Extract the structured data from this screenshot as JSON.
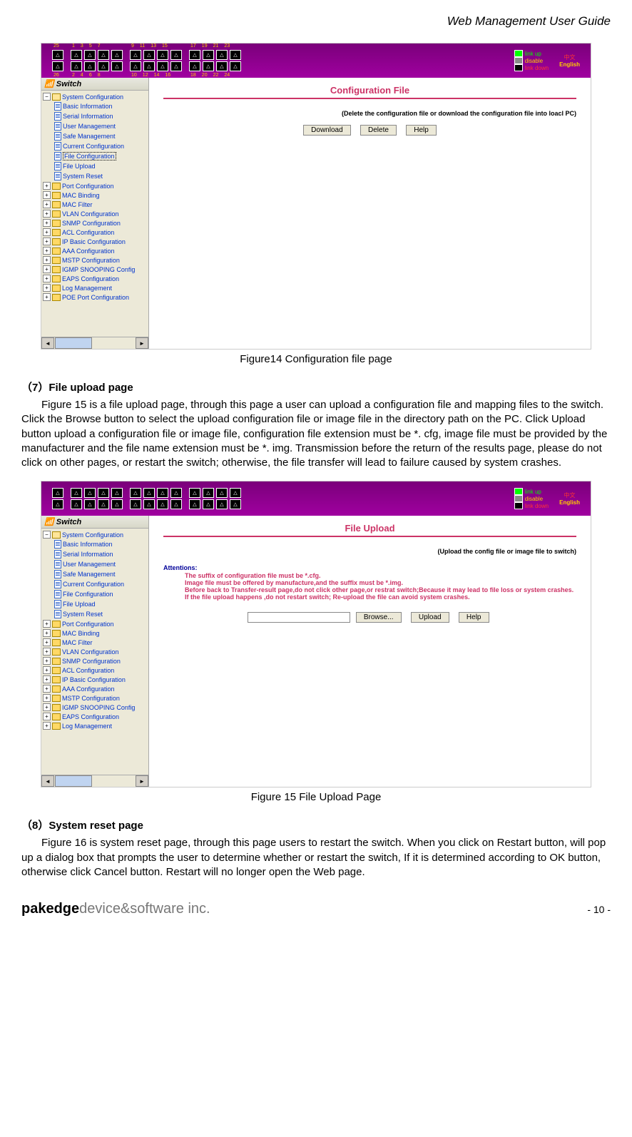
{
  "doc_header": "Web Management User Guide",
  "fig14": {
    "caption": "Figure14 Configuration file page",
    "port_top_labels": [
      "25",
      "",
      "1",
      "3",
      "5",
      "7",
      "",
      "9",
      "11",
      "13",
      "15",
      "",
      "17",
      "19",
      "21",
      "23"
    ],
    "port_bottom_labels": [
      "26",
      "",
      "2",
      "4",
      "6",
      "8",
      "",
      "10",
      "12",
      "14",
      "16",
      "",
      "18",
      "20",
      "22",
      "24"
    ],
    "legend": {
      "link_up": "link up",
      "disable": "disable",
      "link_down": "link down"
    },
    "lang": {
      "cn": "中文",
      "en": "English"
    },
    "sidebar_title": "Switch",
    "tree_l1_open": "System Configuration",
    "tree_l2": [
      "Basic Information",
      "Serial Information",
      "User Management",
      "Safe Management",
      "Current Configuration",
      "File Configuration",
      "File Upload",
      "System Reset"
    ],
    "selected_index": 5,
    "tree_folders": [
      "Port Configuration",
      "MAC Binding",
      "MAC Filter",
      "VLAN Configuration",
      "SNMP Configuration",
      "ACL Configuration",
      "IP Basic Configuration",
      "AAA Configuration",
      "MSTP Configuration",
      "IGMP SNOOPING Config",
      "EAPS Configuration",
      "Log Management",
      "POE Port Configuration"
    ],
    "content_title": "Configuration File",
    "content_note": "(Delete the configuration file or download the configuration file into loacl PC)",
    "buttons": [
      "Download",
      "Delete",
      "Help"
    ]
  },
  "section7": {
    "heading": "（7）File upload page",
    "body": "Figure 15 is a file upload page, through this page a user can upload a configuration file and mapping files to the switch. Click the Browse button to select the upload configuration file or image file in the directory path on the PC. Click Upload button upload a configuration file or image file, configuration file extension must be *. cfg, image file must be provided by the manufacturer and the file name extension must be *. img. Transmission before the return of the results page, please do not click on other pages, or restart the switch; otherwise, the file transfer will lead to failure caused by system crashes."
  },
  "fig15": {
    "caption": "Figure 15 File Upload Page",
    "sidebar_title": "Switch",
    "tree_l1_open": "System Configuration",
    "tree_l2": [
      "Basic Information",
      "Serial Information",
      "User Management",
      "Safe Management",
      "Current Configuration",
      "File Configuration",
      "File Upload",
      "System Reset"
    ],
    "tree_folders": [
      "Port Configuration",
      "MAC Binding",
      "MAC Filter",
      "VLAN Configuration",
      "SNMP Configuration",
      "ACL Configuration",
      "IP Basic Configuration",
      "AAA Configuration",
      "MSTP Configuration",
      "IGMP SNOOPING Config",
      "EAPS Configuration",
      "Log Management"
    ],
    "content_title": "File Upload",
    "content_note": "(Upload the config file or image file to switch)",
    "attentions_label": "Attentions:",
    "attentions_lines": [
      "The suffix of configuration file must be *.cfg.",
      "Image file must be offered by manufacture,and the suffix must be *.img.",
      "Before back to Transfer-result page,do not click other page,or restrat switch;Because it may lead to file loss or system crashes.",
      "If the file upload happens ,do not restart switch; Re-upload the file can avoid system crashes."
    ],
    "browse_btn": "Browse...",
    "upload_btn": "Upload",
    "help_btn": "Help",
    "legend": {
      "link_up": "link up",
      "disable": "disable",
      "link_down": "link down"
    },
    "lang": {
      "cn": "中文",
      "en": "English"
    }
  },
  "section8": {
    "heading": "（8）System reset page",
    "body": "Figure 16 is system reset page, through this page users to restart the switch. When you click on Restart button, will pop up a dialog box that prompts the user to determine whether or restart the switch, If it is determined according to OK button, otherwise click Cancel button. Restart will no longer open the Web page."
  },
  "footer": {
    "brand_bold": "pakedge",
    "brand_rest": "device&software inc.",
    "page": "- 10 -"
  }
}
